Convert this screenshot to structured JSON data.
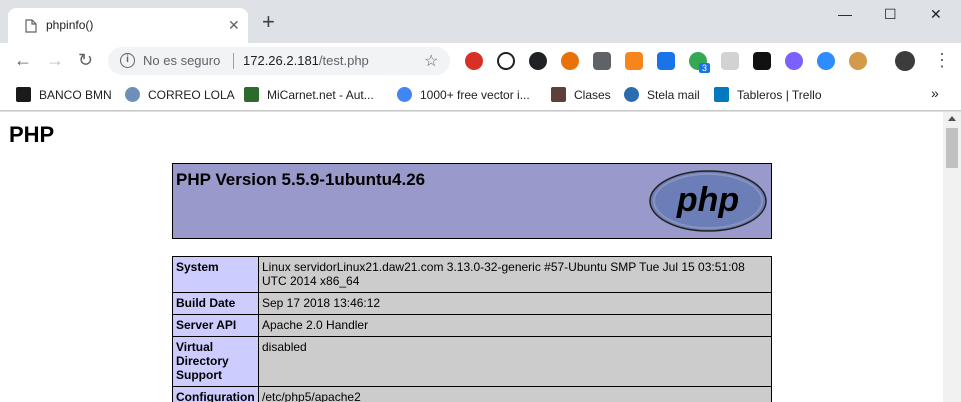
{
  "browser": {
    "tab_title": "phpinfo()",
    "close_glyph": "✕",
    "newtab_glyph": "+",
    "security_label": "No es seguro",
    "url_host": "172.26.2.181",
    "url_path": "/test.php",
    "extension_badge": "3",
    "more_bookmarks": "»",
    "window_controls": {
      "minimize": "—",
      "maximize": "☐",
      "close": "✕"
    },
    "nav": {
      "back": "←",
      "forward": "→",
      "reload": "↻",
      "menu": "⋮",
      "star": "☆",
      "info": "i"
    }
  },
  "bookmarks": [
    {
      "label": "BANCO BMN",
      "icon": "b-logo-icon",
      "color": "#1a1a1a"
    },
    {
      "label": "CORREO LOLA",
      "icon": "mail-icon",
      "color": "#6d8fb8"
    },
    {
      "label": "MiCarnet.net - Aut...",
      "icon": "l-logo-icon",
      "color": "#2d6b2d"
    },
    {
      "label": "1000+ free vector i...",
      "icon": "vector-icon",
      "color": "#4285f4"
    },
    {
      "label": "Clases",
      "icon": "classroom-icon",
      "color": "#5d4037"
    },
    {
      "label": "Stela mail",
      "icon": "stela-icon",
      "color": "#2b6cb0"
    },
    {
      "label": "Tableros | Trello",
      "icon": "trello-icon",
      "color": "#0079bf"
    }
  ],
  "page": {
    "heading": "PHP",
    "version_title": "PHP Version 5.5.9-1ubuntu4.26",
    "logo_text": "php"
  },
  "info_rows": [
    {
      "key": "System",
      "value": "Linux servidorLinux21.daw21.com 3.13.0-32-generic #57-Ubuntu SMP Tue Jul 15 03:51:08 UTC 2014 x86_64"
    },
    {
      "key": "Build Date",
      "value": "Sep 17 2018 13:46:12"
    },
    {
      "key": "Server API",
      "value": "Apache 2.0 Handler"
    },
    {
      "key": "Virtual Directory Support",
      "value": "disabled"
    },
    {
      "key": "Configuration",
      "value": "/etc/php5/apache2"
    }
  ],
  "colors": {
    "php_header": "#9999cc",
    "php_key_cell": "#ccccff",
    "php_value_cell": "#cccccc"
  }
}
